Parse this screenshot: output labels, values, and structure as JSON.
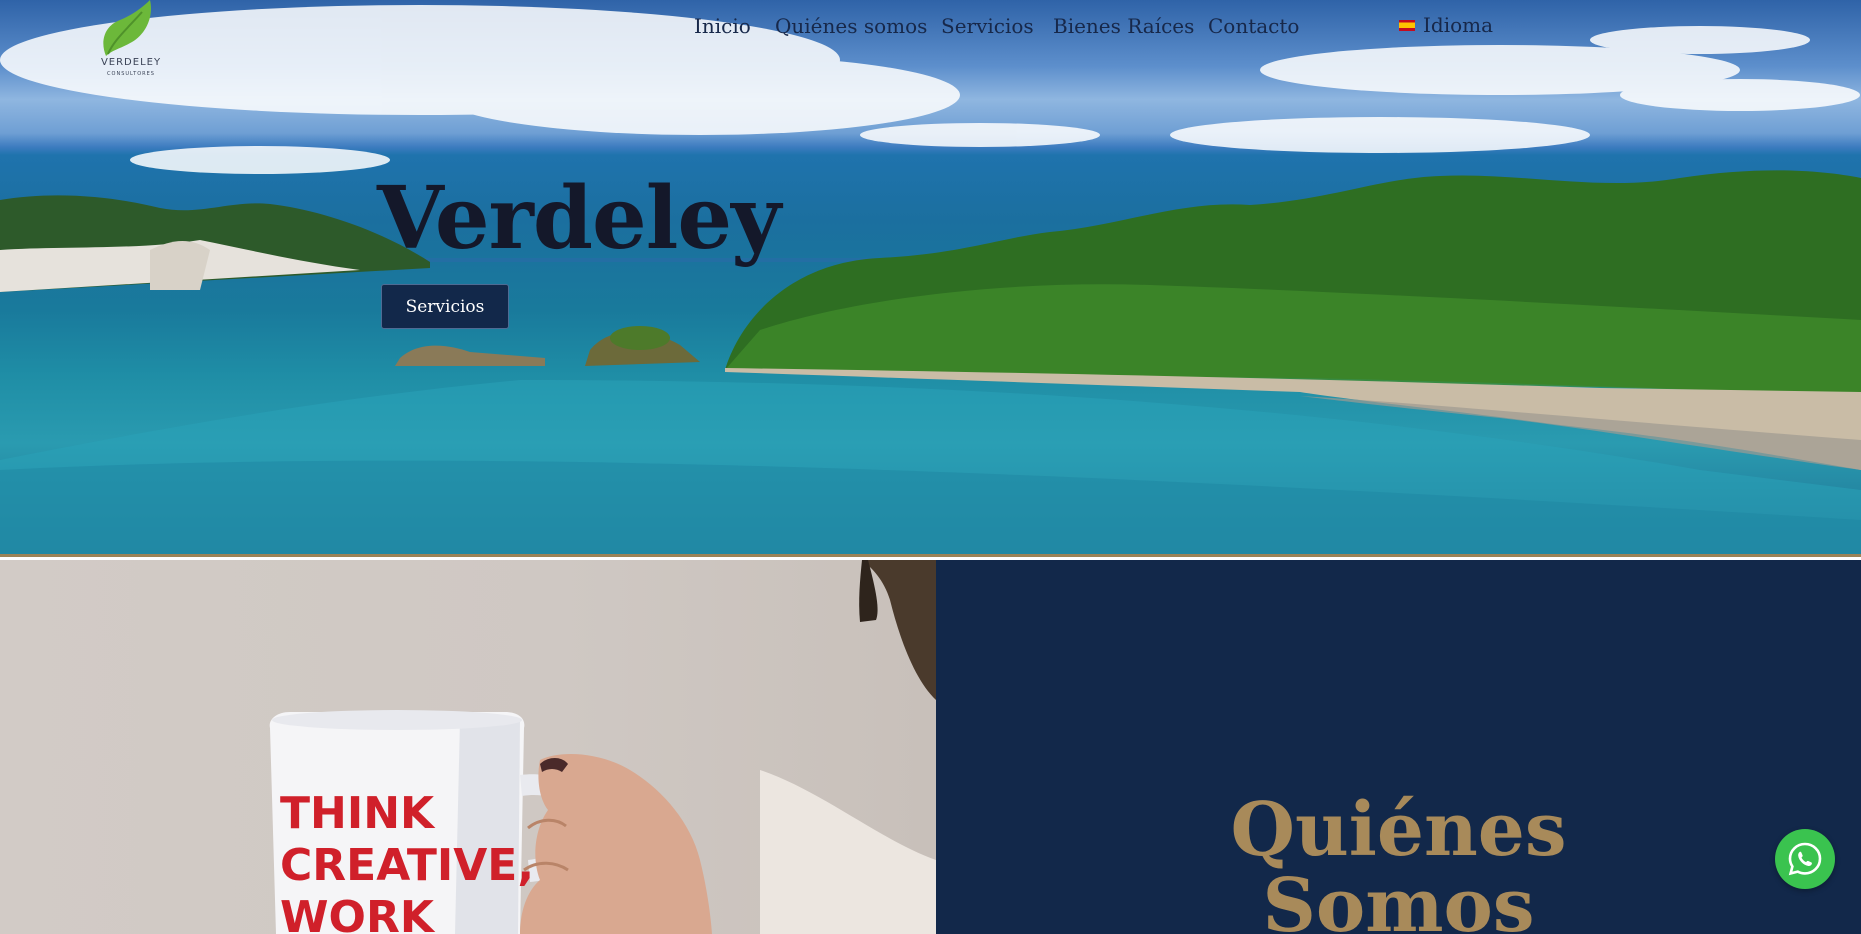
{
  "brand": {
    "name": "VERDELEY",
    "tagline": "CONSULTORES",
    "accent": "#a88a5a",
    "navy": "#12284a"
  },
  "nav": {
    "items": [
      {
        "label": "Inicio"
      },
      {
        "label": "Quiénes somos"
      },
      {
        "label": "Servicios"
      },
      {
        "label": "Bienes Raíces"
      },
      {
        "label": "Contacto"
      }
    ],
    "language_label": "Idioma",
    "language_flag": "spain-flag-icon"
  },
  "hero": {
    "title": "Verdeley",
    "button_label": "Servicios"
  },
  "about": {
    "title_line1": "Quiénes",
    "title_line2": "Somos"
  },
  "photo": {
    "mug_line1": "THINK",
    "mug_line2": "CREATIVE,",
    "mug_line3": "WORK"
  },
  "whatsapp": {
    "icon": "whatsapp-icon"
  }
}
